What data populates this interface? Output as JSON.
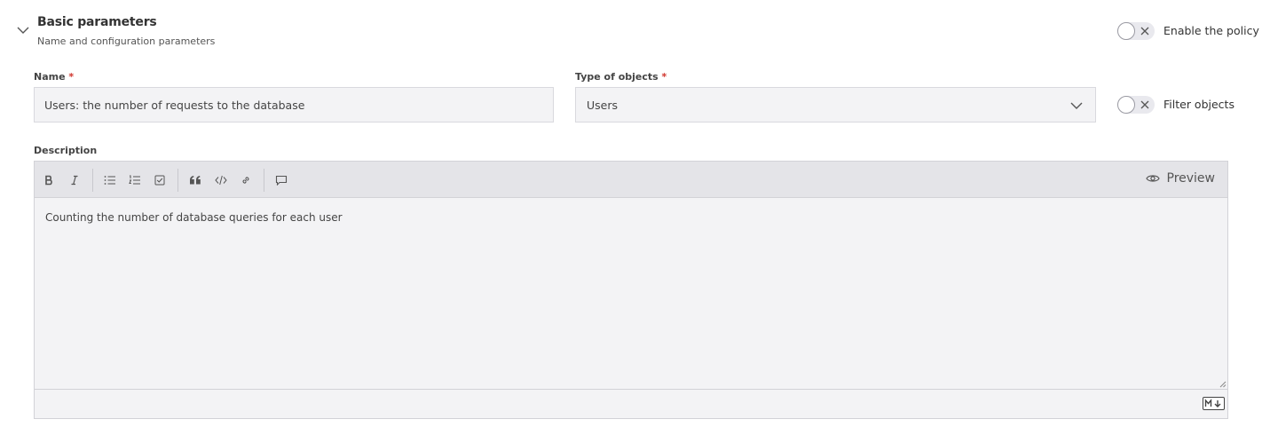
{
  "section": {
    "title": "Basic parameters",
    "subtitle": "Name and configuration parameters",
    "icon": "chevron-down-icon"
  },
  "enable_policy": {
    "label": "Enable the policy",
    "enabled": false
  },
  "filter_objects": {
    "label": "Filter objects",
    "enabled": false
  },
  "name_field": {
    "label": "Name",
    "required_mark": "*",
    "value": "Users: the number of requests to the database"
  },
  "type_field": {
    "label": "Type of objects",
    "required_mark": "*",
    "value": "Users"
  },
  "description": {
    "label": "Description",
    "content": "Counting the number of database queries for each user",
    "preview_label": "Preview",
    "toolbar_icons": [
      "bold-icon",
      "italic-icon",
      "bulleted-list-icon",
      "numbered-list-icon",
      "checklist-icon",
      "quote-icon",
      "code-icon",
      "link-icon",
      "comment-icon"
    ],
    "footer_badge": "markdown-icon"
  },
  "colors": {
    "required": "#d0342c",
    "input_bg": "#f3f3f5",
    "toolbar_bg": "#e4e4e8"
  }
}
